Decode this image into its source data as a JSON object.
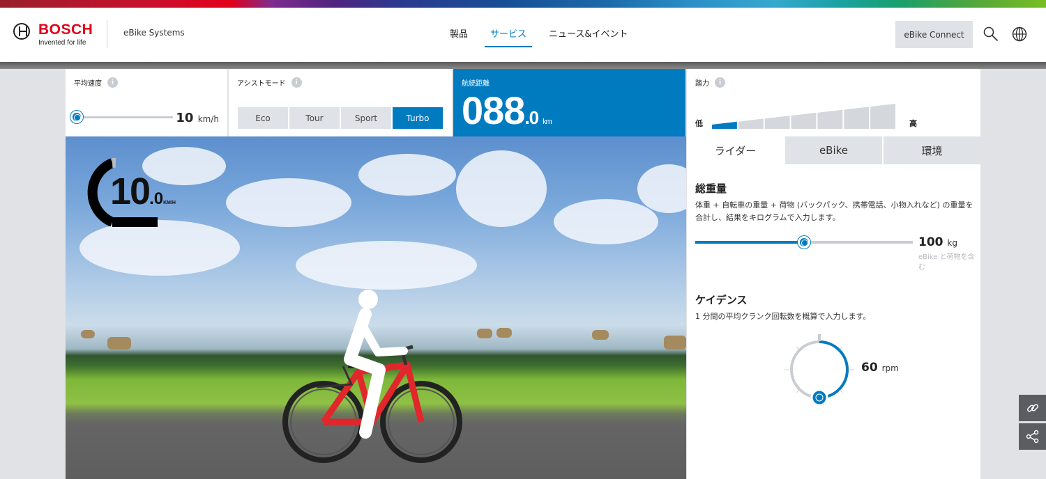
{
  "brand": {
    "wordmark": "BOSCH",
    "tagline": "Invented for life",
    "site_name": "eBike Systems",
    "color": "#e2001a"
  },
  "nav": {
    "items": [
      {
        "label": "製品"
      },
      {
        "label": "サービス",
        "active": true
      },
      {
        "label": "ニュース&イベント"
      }
    ]
  },
  "header": {
    "connect_label": "eBike Connect",
    "search_icon": "search-icon",
    "globe_icon": "globe-icon"
  },
  "panels": {
    "avg_speed": {
      "label": "平均速度",
      "value": "10",
      "unit": "km/h",
      "level": 0
    },
    "assist": {
      "label": "アシストモード",
      "modes": [
        "Eco",
        "Tour",
        "Sport",
        "Turbo"
      ],
      "active": "Turbo"
    },
    "range": {
      "label": "航続距離",
      "value_int": "088",
      "value_dec": ".0",
      "unit": "km"
    },
    "power": {
      "label": "踏力",
      "low": "低",
      "high": "高",
      "segments": 7,
      "level_fraction": 0.14
    }
  },
  "info_glyph": "i",
  "scene": {
    "speed_int": "10",
    "speed_dec": ".0",
    "speed_unit": "KM/H"
  },
  "tabs": [
    {
      "label": "ライダー",
      "active": true
    },
    {
      "label": "eBike"
    },
    {
      "label": "環境"
    }
  ],
  "weight": {
    "title": "総重量",
    "desc": "体重 + 自転車の重量 + 荷物 (バックパック、携帯電話、小物入れなど) の重量を合計し、結果をキログラムで入力します。",
    "value": "100",
    "unit": "kg",
    "note": "eBike と荷物を含む",
    "fraction": 0.5
  },
  "cadence": {
    "title": "ケイデンス",
    "desc": "1 分間の平均クランク回転数を概算で入力します。",
    "value": "60",
    "unit": "rpm"
  },
  "side_buttons": [
    "link-icon",
    "share-icon"
  ],
  "colors": {
    "accent": "#007bc0",
    "track": "#c9cdd2",
    "tab_bg": "#dfe2e6"
  }
}
